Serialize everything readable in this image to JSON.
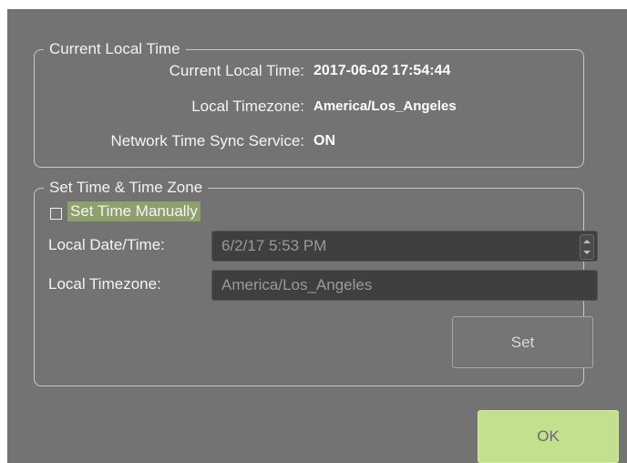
{
  "current_time_group": {
    "legend": "Current Local Time",
    "rows": [
      {
        "label": "Current Local Time:",
        "value": "2017-06-02 17:54:44"
      },
      {
        "label": "Local Timezone:",
        "value": "America/Los_Angeles"
      },
      {
        "label": "Network Time Sync Service:",
        "value": "ON"
      }
    ]
  },
  "set_time_group": {
    "legend": "Set Time & Time Zone",
    "manual_checkbox": {
      "label": "Set Time Manually",
      "checked": false
    },
    "datetime": {
      "label": "Local Date/Time:",
      "value": "6/2/17 5:53 PM"
    },
    "timezone": {
      "label": "Local Timezone:",
      "value": "America/Los_Angeles"
    },
    "set_button": "Set"
  },
  "ok_button": "OK",
  "colors": {
    "dialog_bg": "#737373",
    "ok_button_bg": "#c2e08e",
    "checkbox_label_highlight": "#8ea06b",
    "input_bg": "#3f3f3f"
  }
}
